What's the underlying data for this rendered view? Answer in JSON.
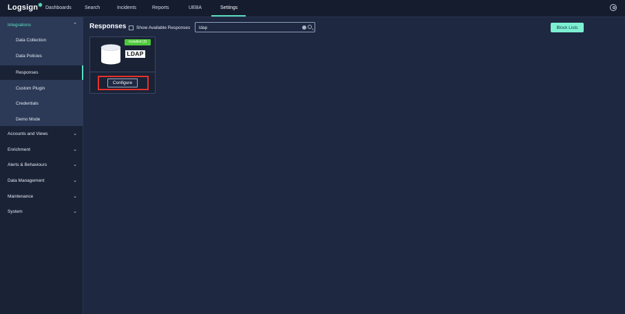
{
  "app": {
    "logo": "Logsign",
    "nav": [
      "Dashboards",
      "Search",
      "Incidents",
      "Reports",
      "UEBA",
      "Settings"
    ],
    "active_nav": "Settings"
  },
  "sidebar": {
    "expanded_section": "Integrations",
    "sub_items": [
      "Data Collection",
      "Data Policies",
      "Responses",
      "Custom Plugin",
      "Credentials",
      "Demo Mode"
    ],
    "active_sub_item": "Responses",
    "sections": [
      "Accounts and Views",
      "Enrichment",
      "Alerts & Behaviours",
      "Data Management",
      "Maintenance",
      "System"
    ]
  },
  "main": {
    "title": "Responses",
    "show_available_label": "Show Available Responses",
    "show_available_checked": false,
    "search": {
      "value": "ldap",
      "placeholder": ""
    },
    "block_lists_label": "Block Lists"
  },
  "card": {
    "badge": "Installed (3)",
    "logo_text": "LDAP",
    "icon": "database-icon",
    "configure_label": "Configure"
  },
  "colors": {
    "accent": "#5ce0c0",
    "badge": "#4ec93b",
    "highlight": "#e8312a",
    "background": "#1e2841"
  }
}
